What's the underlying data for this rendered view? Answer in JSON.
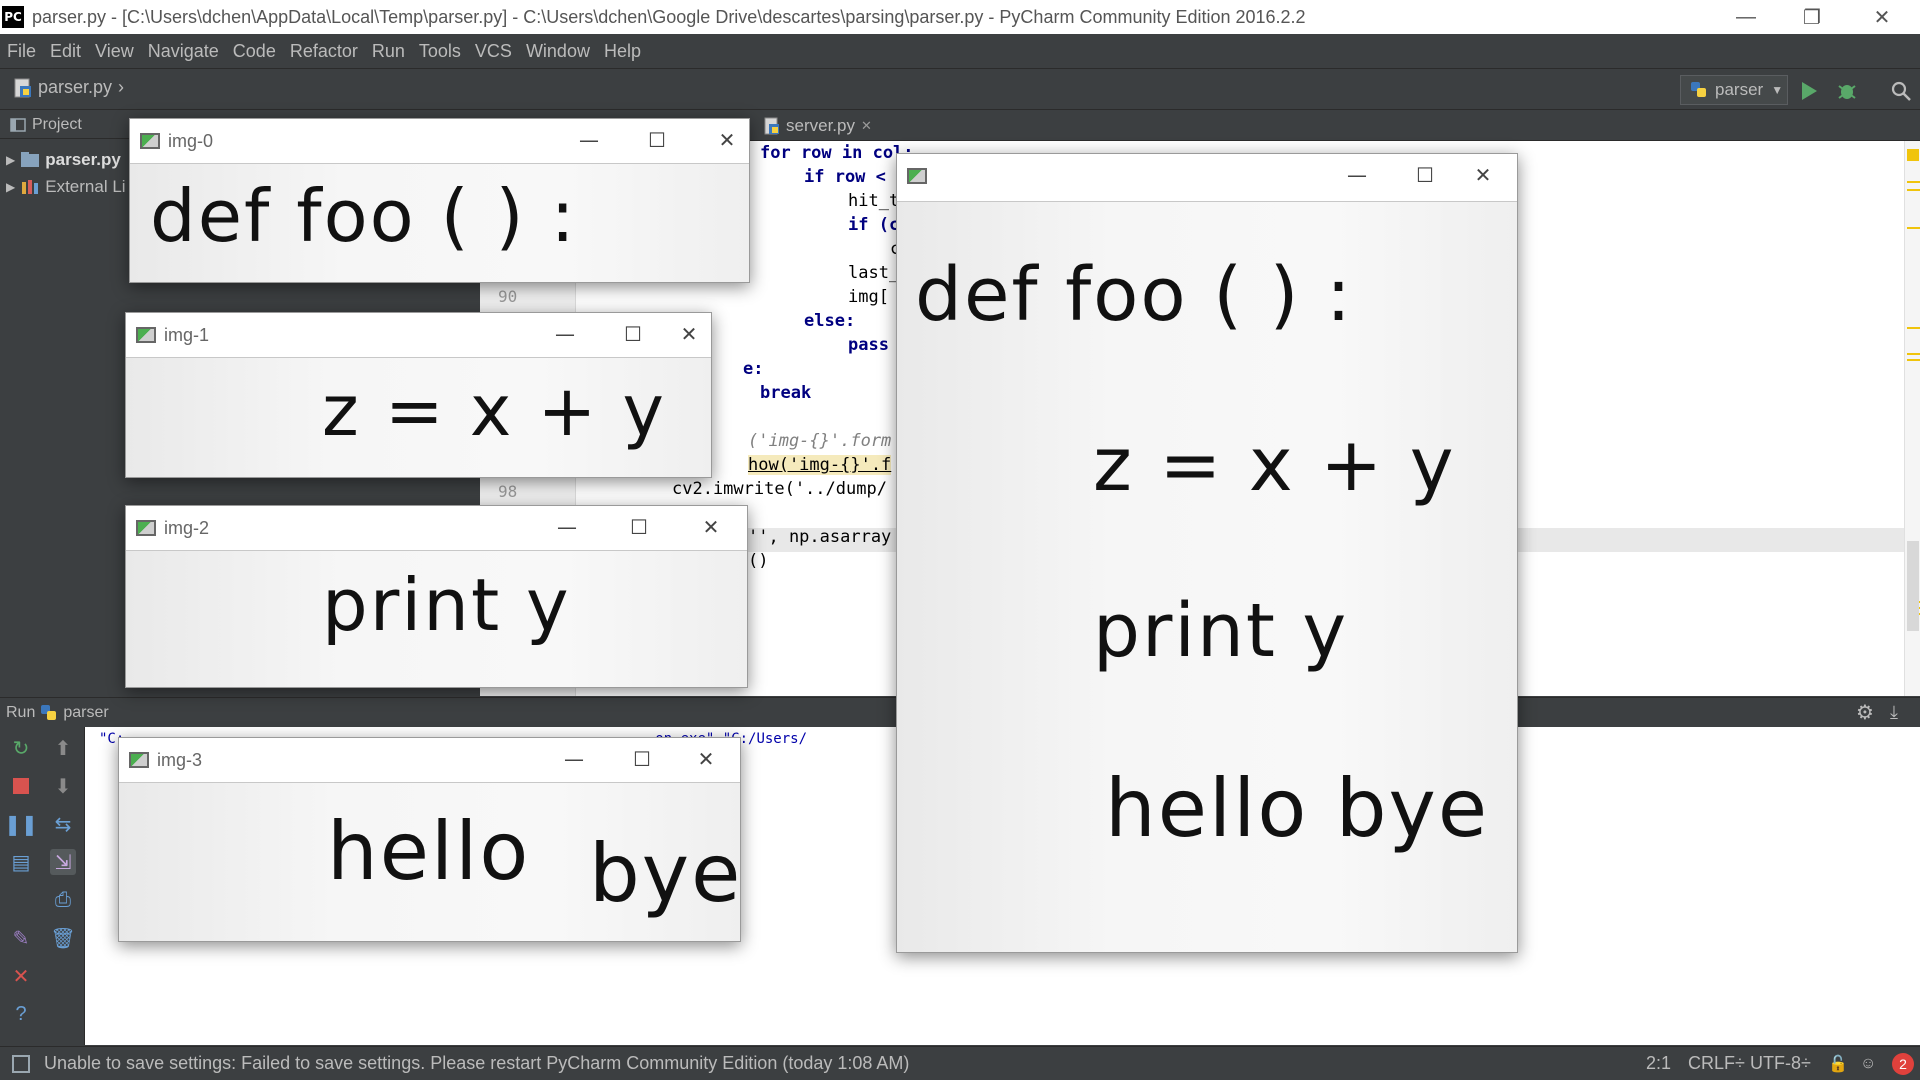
{
  "titlebar": {
    "logo": "PC",
    "title": "parser.py - [C:\\Users\\dchen\\AppData\\Local\\Temp\\parser.py] - C:\\Users\\dchen\\Google Drive\\descartes\\parsing\\parser.py - PyCharm Community Edition 2016.2.2",
    "minimize": "—",
    "restore": "❐",
    "close": "✕"
  },
  "menu": [
    "File",
    "Edit",
    "View",
    "Navigate",
    "Code",
    "Refactor",
    "Run",
    "Tools",
    "VCS",
    "Window",
    "Help"
  ],
  "navbar": {
    "file": "parser.py",
    "run_config": "parser",
    "icons": [
      "python-file-icon",
      "run-icon",
      "debug-icon",
      "search-icon"
    ]
  },
  "project": {
    "header": "Project",
    "items": [
      {
        "label": "parser.py"
      },
      {
        "label": "External Li"
      }
    ]
  },
  "editor": {
    "tab": "server.py",
    "tab_close": "✕",
    "line_numbers": [
      "90",
      "98"
    ],
    "lines": [
      "for row in col:",
      "if row <",
      "hit_t",
      "if (c",
      "c",
      "last_",
      "img[",
      "else:",
      "pass",
      "e:",
      "break",
      "('img-{}'.form",
      "how('img-{}'.f",
      "cv2.imwrite('../dump/",
      "'', np.asarray",
      "()"
    ]
  },
  "run": {
    "header": "Run",
    "config": "parser",
    "console_line": "\"C:                                                               on.exe\" \"C:/Users/"
  },
  "status": {
    "message": "Unable to save settings: Failed to save settings. Please restart PyCharm Community Edition (today 1:08 AM)",
    "position": "2:1",
    "line_sep": "CRLF÷",
    "encoding": "UTF-8÷",
    "notifications": "2"
  },
  "windows": [
    {
      "title": "img-0",
      "text": "def   foo ( ) :"
    },
    {
      "title": "img-1",
      "text": "z = x + y"
    },
    {
      "title": "img-2",
      "text": "print   y"
    },
    {
      "title": "img-3",
      "text_a": "hello",
      "text_b": "bye"
    },
    {
      "title": "",
      "lines": [
        "def   foo ( ) :",
        "z = x + y",
        "print   y",
        "hello      bye"
      ]
    }
  ],
  "window_buttons": {
    "minimize": "—",
    "maximize": "☐",
    "close": "✕"
  },
  "colors": {
    "accent_run": "#59a869",
    "accent_debug": "#59a869",
    "badge": "#e0413c",
    "marker": "#f0c40c"
  }
}
